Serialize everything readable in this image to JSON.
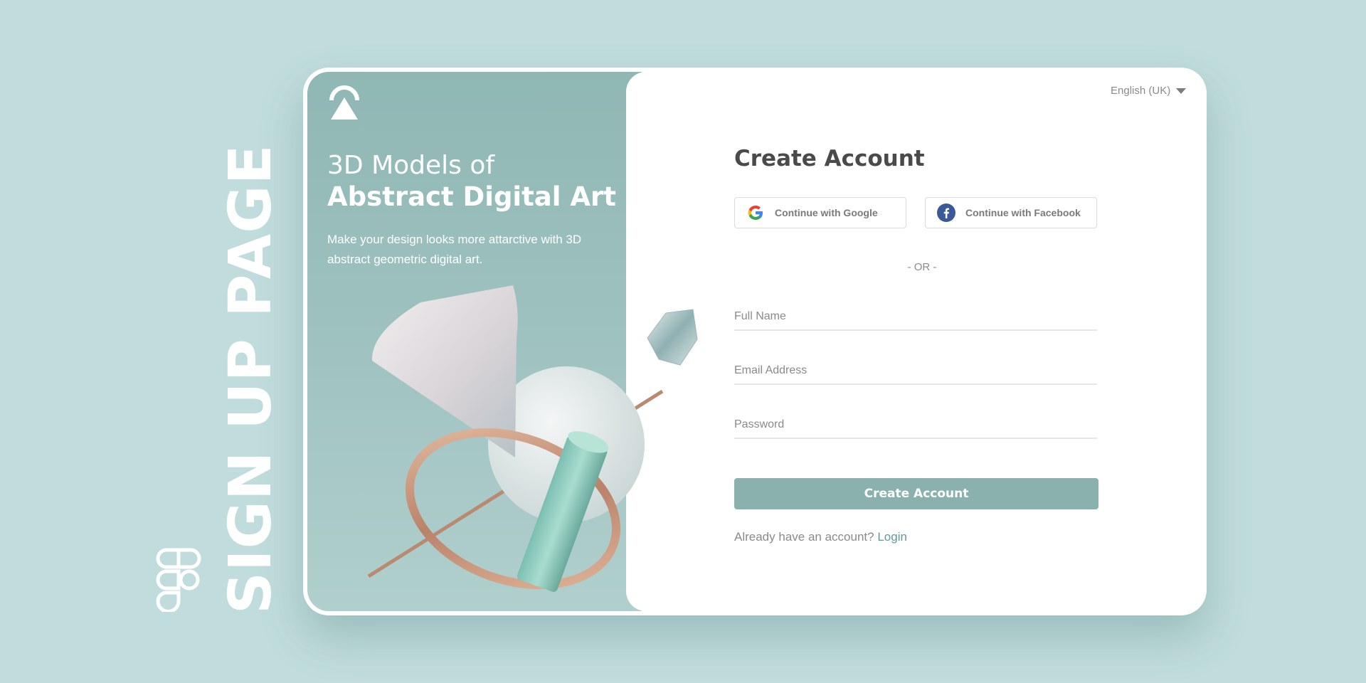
{
  "page": {
    "side_title": "SIGN UP PAGE"
  },
  "hero": {
    "title_line1": "3D Models of",
    "title_line2": "Abstract Digital Art",
    "subtitle": "Make your design looks more attarctive with 3D abstract geometric digital art."
  },
  "language": {
    "label": "English (UK)"
  },
  "form": {
    "title": "Create Account",
    "google_label": "Continue with Google",
    "facebook_label": "Continue with Facebook",
    "divider": "- OR -",
    "full_name_placeholder": "Full Name",
    "email_placeholder": "Email Address",
    "password_placeholder": "Password",
    "submit_label": "Create Account",
    "login_prompt": "Already have an account?",
    "login_link": "Login"
  },
  "colors": {
    "background": "#c0dcdc",
    "accent": "#8bb1ae",
    "link": "#5f9a97",
    "title": "#4a4a4a"
  },
  "icons": {
    "brand": "brand-arch-icon",
    "figma": "figma-icon",
    "google": "google-icon",
    "facebook": "facebook-icon",
    "dropdown": "chevron-down-icon"
  }
}
